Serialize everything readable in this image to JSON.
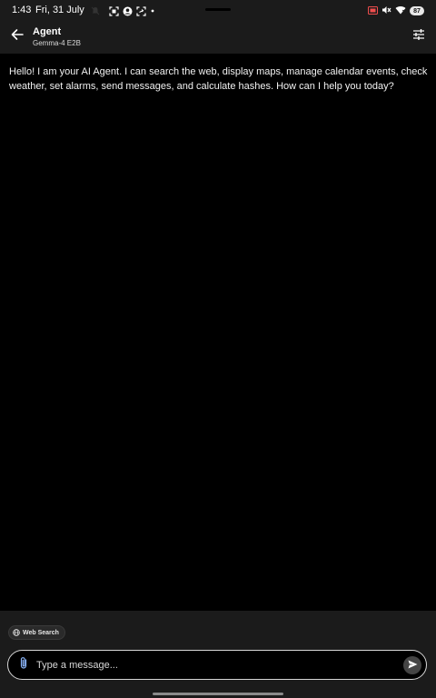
{
  "status_bar": {
    "time": "1:43",
    "date": "Fri, 31 July",
    "battery": "87",
    "icons_left": [
      "muted-bell-icon",
      "screenshot-icon",
      "account-icon",
      "sync-icon",
      "dot-icon"
    ],
    "icons_right": [
      "cast-icon",
      "volume-off-icon",
      "wifi-icon",
      "battery-icon"
    ]
  },
  "header": {
    "title": "Agent",
    "subtitle": "Gemma-4 E2B",
    "back_icon": "arrow-left-icon",
    "settings_icon": "tune-icon"
  },
  "messages": [
    {
      "role": "agent",
      "text": "Hello! I am your AI Agent. I can search the web, display maps, manage calendar events, check weather, set alarms, send messages, and calculate hashes. How can I help you today?"
    }
  ],
  "composer": {
    "chip_label": "Web Search",
    "chip_icon": "globe-icon",
    "placeholder": "Type a message...",
    "value": "",
    "attach_icon": "paperclip-icon",
    "send_icon": "send-icon"
  },
  "colors": {
    "background": "#000000",
    "bar": "#1b1b1b",
    "attach_accent": "#8ab4f8"
  }
}
